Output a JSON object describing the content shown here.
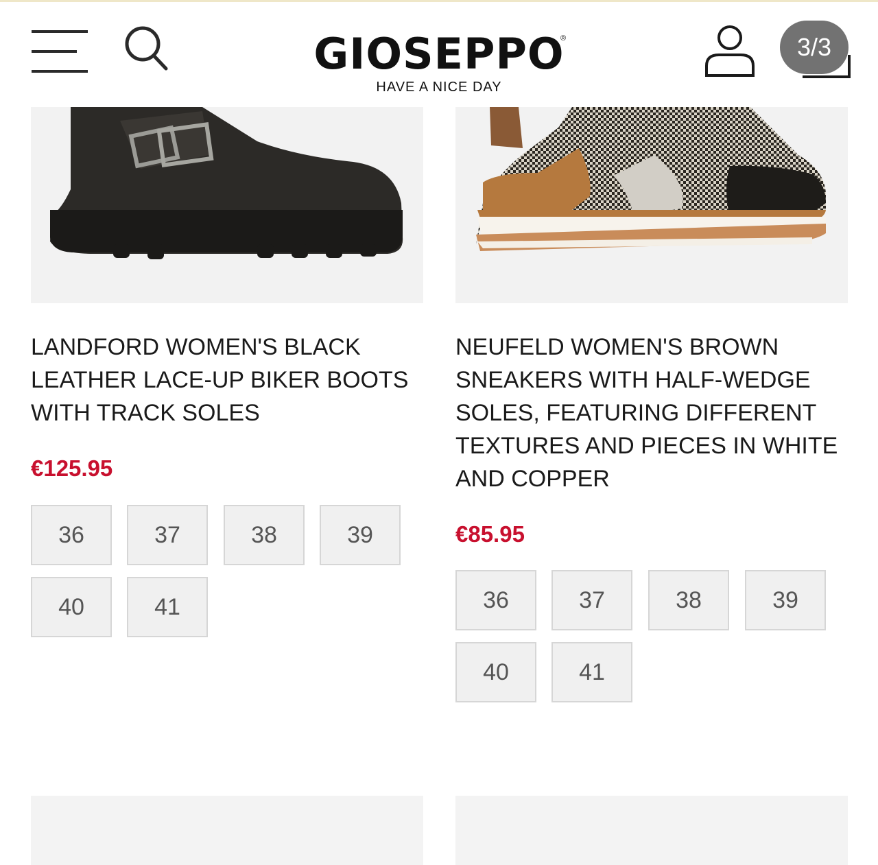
{
  "header": {
    "logo_text": "GIOSEPPO",
    "logo_registered": "®",
    "tagline": "HAVE A NICE DAY",
    "pager": "3/3",
    "icons": {
      "menu": "menu-icon",
      "search": "search-icon",
      "account": "account-icon",
      "cart": "cart-icon"
    }
  },
  "products": [
    {
      "title": "LANDFORD WOMEN'S BLACK LEATHER LACE-UP BIKER BOOTS WITH TRACK SOLES",
      "price": "€125.95",
      "sizes": [
        "36",
        "37",
        "38",
        "39",
        "40",
        "41"
      ]
    },
    {
      "title": "NEUFELD WOMEN'S BROWN SNEAKERS WITH HALF-WEDGE SOLES, FEATURING DIFFERENT TEXTURES AND PIECES IN WHITE AND COPPER",
      "price": "€85.95",
      "sizes": [
        "36",
        "37",
        "38",
        "39",
        "40",
        "41"
      ]
    }
  ],
  "colors": {
    "price": "#c8102e",
    "size_bg": "#f0f0f0",
    "size_border": "#d6d6d6"
  }
}
